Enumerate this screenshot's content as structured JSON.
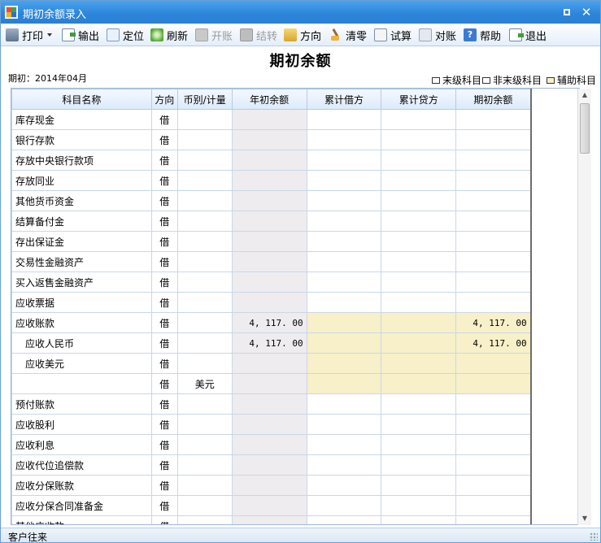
{
  "window": {
    "title": "期初余额录入"
  },
  "toolbar": {
    "print": "打印",
    "export": "输出",
    "locate": "定位",
    "refresh": "刷新",
    "open_account": "开账",
    "settle": "结转",
    "direction": "方向",
    "clear": "清零",
    "trial_balance": "试算",
    "reconcile": "对账",
    "help": "帮助",
    "exit": "退出"
  },
  "header": {
    "title": "期初余额",
    "period": "期初：2014年04月",
    "legend": {
      "leaf": "末级科目",
      "nonleaf": "非末级科目",
      "aux": "辅助科目"
    }
  },
  "grid": {
    "columns": [
      "科目名称",
      "方向",
      "币别/计量",
      "年初余额",
      "累计借方",
      "累计贷方",
      "期初余额"
    ],
    "rows": [
      {
        "name": "库存现金",
        "dir": "借",
        "currency": "",
        "year_start": "",
        "debit": "",
        "credit": "",
        "opening": ""
      },
      {
        "name": "银行存款",
        "dir": "借",
        "currency": "",
        "year_start": "",
        "debit": "",
        "credit": "",
        "opening": ""
      },
      {
        "name": "存放中央银行款项",
        "dir": "借",
        "currency": "",
        "year_start": "",
        "debit": "",
        "credit": "",
        "opening": ""
      },
      {
        "name": "存放同业",
        "dir": "借",
        "currency": "",
        "year_start": "",
        "debit": "",
        "credit": "",
        "opening": ""
      },
      {
        "name": "其他货币资金",
        "dir": "借",
        "currency": "",
        "year_start": "",
        "debit": "",
        "credit": "",
        "opening": ""
      },
      {
        "name": "结算备付金",
        "dir": "借",
        "currency": "",
        "year_start": "",
        "debit": "",
        "credit": "",
        "opening": ""
      },
      {
        "name": "存出保证金",
        "dir": "借",
        "currency": "",
        "year_start": "",
        "debit": "",
        "credit": "",
        "opening": ""
      },
      {
        "name": "交易性金融资产",
        "dir": "借",
        "currency": "",
        "year_start": "",
        "debit": "",
        "credit": "",
        "opening": ""
      },
      {
        "name": "买入返售金融资产",
        "dir": "借",
        "currency": "",
        "year_start": "",
        "debit": "",
        "credit": "",
        "opening": ""
      },
      {
        "name": "应收票据",
        "dir": "借",
        "currency": "",
        "year_start": "",
        "debit": "",
        "credit": "",
        "opening": ""
      },
      {
        "name": "应收账款",
        "dir": "借",
        "currency": "",
        "year_start": "4, 117. 00",
        "debit": "",
        "credit": "",
        "opening": "4, 117. 00",
        "aux": true
      },
      {
        "name": "应收人民币",
        "dir": "借",
        "currency": "",
        "year_start": "4, 117. 00",
        "debit": "",
        "credit": "",
        "opening": "4, 117. 00",
        "aux": true,
        "child": true
      },
      {
        "name": "应收美元",
        "dir": "借",
        "currency": "",
        "year_start": "",
        "debit": "",
        "credit": "",
        "opening": "",
        "aux": true,
        "child": true
      },
      {
        "name": "",
        "dir": "借",
        "currency": "美元",
        "year_start": "",
        "debit": "",
        "credit": "",
        "opening": "",
        "aux": true
      },
      {
        "name": "预付账款",
        "dir": "借",
        "currency": "",
        "year_start": "",
        "debit": "",
        "credit": "",
        "opening": ""
      },
      {
        "name": "应收股利",
        "dir": "借",
        "currency": "",
        "year_start": "",
        "debit": "",
        "credit": "",
        "opening": ""
      },
      {
        "name": "应收利息",
        "dir": "借",
        "currency": "",
        "year_start": "",
        "debit": "",
        "credit": "",
        "opening": ""
      },
      {
        "name": "应收代位追偿款",
        "dir": "借",
        "currency": "",
        "year_start": "",
        "debit": "",
        "credit": "",
        "opening": ""
      },
      {
        "name": "应收分保账款",
        "dir": "借",
        "currency": "",
        "year_start": "",
        "debit": "",
        "credit": "",
        "opening": ""
      },
      {
        "name": "应收分保合同准备金",
        "dir": "借",
        "currency": "",
        "year_start": "",
        "debit": "",
        "credit": "",
        "opening": ""
      },
      {
        "name": "其他应收款",
        "dir": "借",
        "currency": "",
        "year_start": "",
        "debit": "",
        "credit": "",
        "opening": ""
      }
    ]
  },
  "status": {
    "text": "客户往来"
  },
  "colors": {
    "title_bar": "#2d86da",
    "aux_fill": "#f7f0c8",
    "opening_fill": "#eeecef"
  }
}
